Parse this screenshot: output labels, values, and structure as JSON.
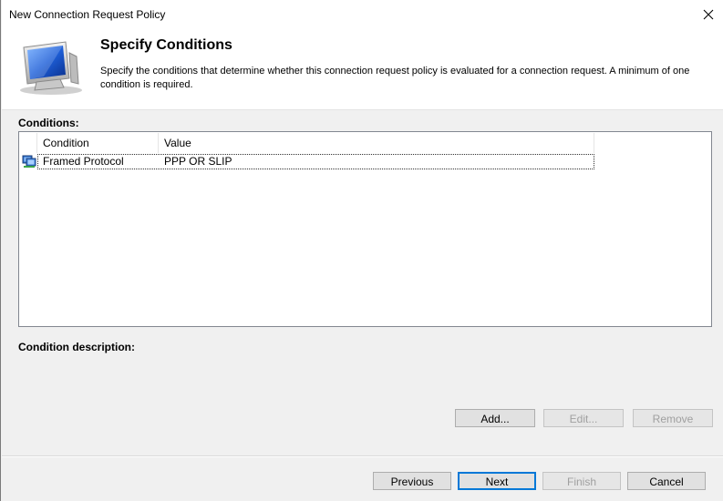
{
  "window": {
    "title": "New Connection Request Policy"
  },
  "header": {
    "title": "Specify Conditions",
    "description": "Specify the conditions that determine whether this connection request policy is evaluated for a connection request. A minimum of one condition is required."
  },
  "conditions": {
    "label": "Conditions:",
    "columns": {
      "condition": "Condition",
      "value": "Value"
    },
    "rows": [
      {
        "condition": "Framed Protocol",
        "value": "PPP OR SLIP",
        "icon": "network-policy-icon"
      }
    ]
  },
  "description": {
    "label": "Condition description:"
  },
  "actions": {
    "add": "Add...",
    "edit": "Edit...",
    "remove": "Remove"
  },
  "footer": {
    "previous": "Previous",
    "next": "Next",
    "finish": "Finish",
    "cancel": "Cancel"
  }
}
